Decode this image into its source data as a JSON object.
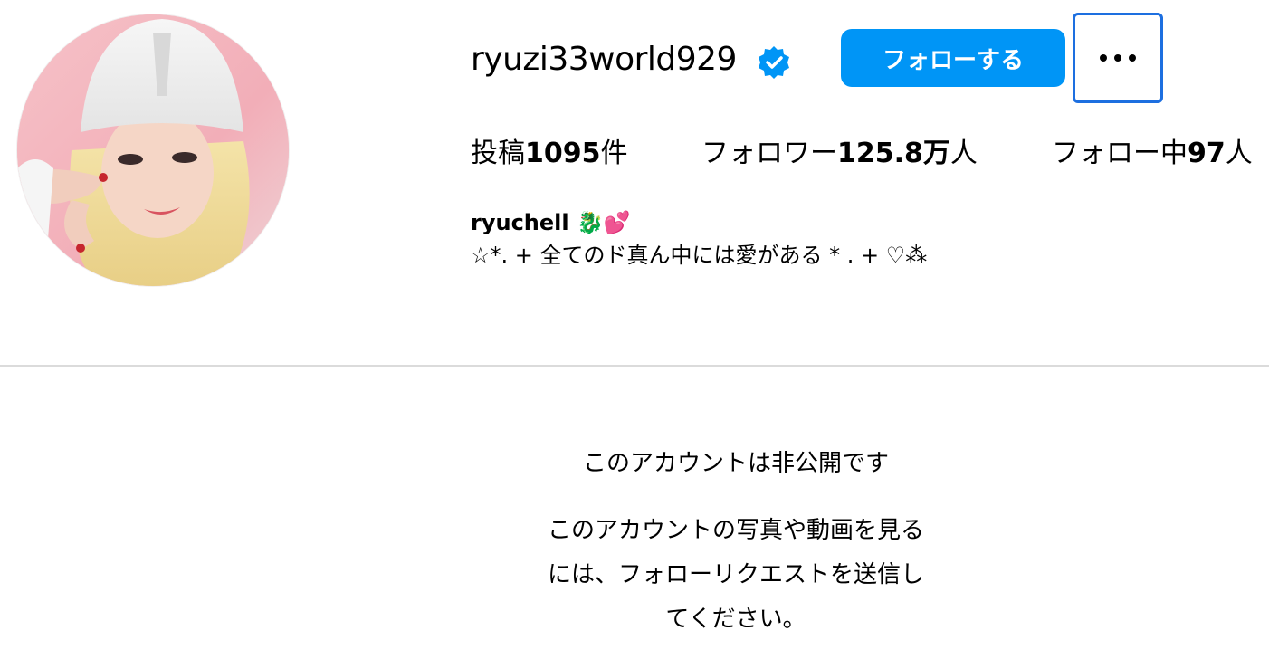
{
  "profile": {
    "username": "ryuzi33world929",
    "follow_label": "フォローする",
    "more_icon": "more-horizontal-icon",
    "verified_icon": "verified-badge-icon",
    "accent_color": "#0095f6"
  },
  "stats": {
    "posts_prefix": "投稿",
    "posts_count": "1095",
    "posts_suffix": "件",
    "followers_prefix": "フォロワー",
    "followers_count": "125.8万",
    "followers_suffix": "人",
    "following_prefix": "フォロー中",
    "following_count": "97",
    "following_suffix": "人"
  },
  "bio": {
    "name": "ryuchell 🐉💕",
    "text": "☆*. + 全てのド真ん中には愛がある * . + ♡⁂"
  },
  "private": {
    "title": "このアカウントは非公開です",
    "line1": "このアカウントの写真や動画を見る",
    "line2": "には、フォローリクエストを送信し",
    "line3": "てください。"
  }
}
